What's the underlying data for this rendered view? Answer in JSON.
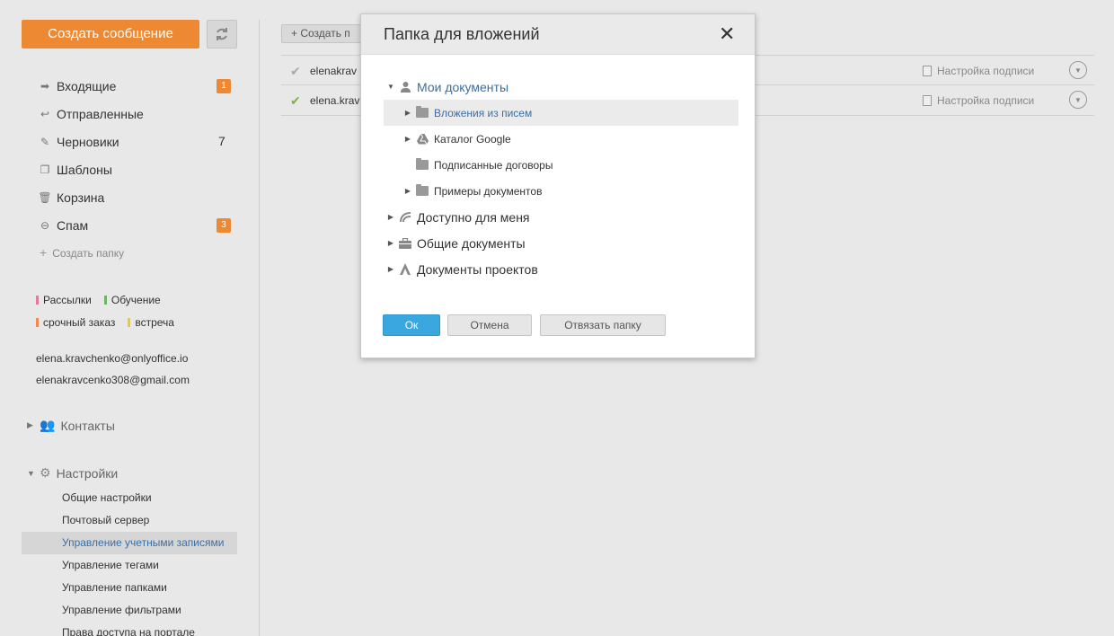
{
  "sidebar": {
    "compose_label": "Создать сообщение",
    "folders": [
      {
        "label": "Входящие",
        "icon": "arrow-right-icon",
        "badge": "1"
      },
      {
        "label": "Отправленные",
        "icon": "reply-icon"
      },
      {
        "label": "Черновики",
        "icon": "edit-icon",
        "count": "7"
      },
      {
        "label": "Шаблоны",
        "icon": "copy-icon"
      },
      {
        "label": "Корзина",
        "icon": "trash-icon"
      },
      {
        "label": "Спам",
        "icon": "block-icon",
        "badge": "3"
      }
    ],
    "create_folder_label": "Создать папку",
    "tags": [
      {
        "label": "Рассылки",
        "color": "#e27d98"
      },
      {
        "label": "Обучение",
        "color": "#6cb36c"
      },
      {
        "label": "срочный заказ",
        "color": "#ef8a55"
      },
      {
        "label": "встреча",
        "color": "#d8c96e"
      }
    ],
    "accounts": [
      "elena.kravchenko@onlyoffice.io",
      "elenakravcenko308@gmail.com"
    ],
    "contacts_label": "Контакты",
    "settings_label": "Настройки",
    "settings_items": [
      "Общие настройки",
      "Почтовый сервер",
      "Управление учетными записями",
      "Управление тегами",
      "Управление папками",
      "Управление фильтрами",
      "Права доступа на портале"
    ]
  },
  "main": {
    "create_button_label": "Создать п",
    "rows": [
      {
        "email": "elenakrav",
        "signature": "Настройка подписи",
        "check_color": "#aaaaaa"
      },
      {
        "email": "elena.krav",
        "signature": "Настройка подписи",
        "check_color": "#7cb342"
      }
    ]
  },
  "modal": {
    "title": "Папка для вложений",
    "tree": {
      "my_docs": "Мои документы",
      "children": [
        "Вложения из писем",
        "Каталог Google",
        "Подписанные договоры",
        "Примеры документов"
      ],
      "available": "Доступно для меня",
      "common": "Общие документы",
      "projects": "Документы проектов"
    },
    "ok_label": "Ок",
    "cancel_label": "Отмена",
    "unlink_label": "Отвязать папку"
  }
}
